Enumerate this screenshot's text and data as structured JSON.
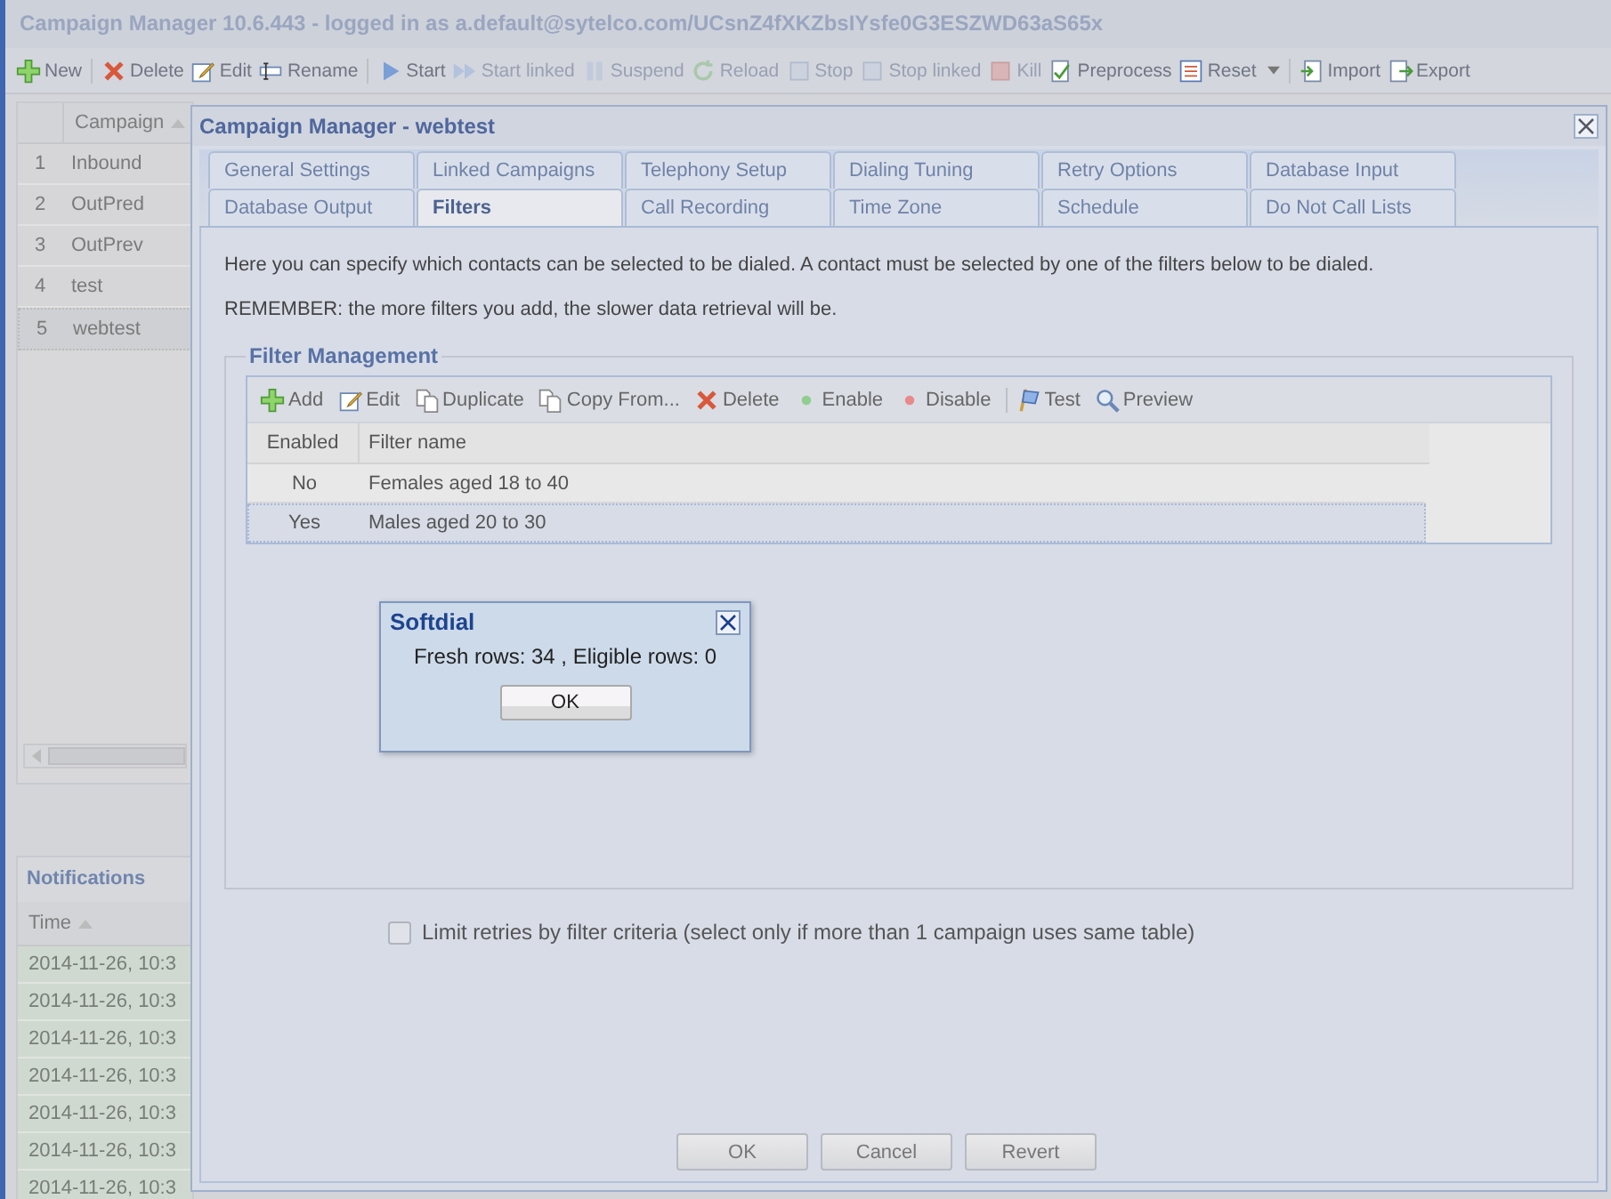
{
  "app": {
    "title": "Campaign Manager 10.6.443 - logged in as a.default@sytelco.com/UCsnZ4fXKZbsIYsfe0G3ESZWD63aS65x",
    "toolbar": [
      {
        "label": "New",
        "kind": "plus",
        "disabled": false,
        "caret": false,
        "sep_before": false
      },
      {
        "label": "Delete",
        "kind": "cross",
        "disabled": false,
        "caret": false,
        "sep_before": true
      },
      {
        "label": "Edit",
        "kind": "pencil",
        "disabled": false,
        "caret": false,
        "sep_before": false
      },
      {
        "label": "Rename",
        "kind": "rename",
        "disabled": false,
        "caret": false,
        "sep_before": false
      },
      {
        "label": "Start",
        "kind": "play",
        "disabled": false,
        "caret": false,
        "sep_before": true
      },
      {
        "label": "Start linked",
        "kind": "play2",
        "disabled": true,
        "caret": false,
        "sep_before": false
      },
      {
        "label": "Suspend",
        "kind": "pause",
        "disabled": true,
        "caret": false,
        "sep_before": false
      },
      {
        "label": "Reload",
        "kind": "reload",
        "disabled": true,
        "caret": false,
        "sep_before": false
      },
      {
        "label": "Stop",
        "kind": "stop",
        "disabled": true,
        "caret": false,
        "sep_before": false
      },
      {
        "label": "Stop linked",
        "kind": "stop",
        "disabled": true,
        "caret": false,
        "sep_before": false
      },
      {
        "label": "Kill",
        "kind": "kill",
        "disabled": true,
        "caret": false,
        "sep_before": false
      },
      {
        "label": "Preprocess",
        "kind": "check",
        "disabled": false,
        "caret": false,
        "sep_before": false
      },
      {
        "label": "Reset",
        "kind": "list",
        "disabled": false,
        "caret": true,
        "sep_before": false
      },
      {
        "label": "Import",
        "kind": "import",
        "disabled": false,
        "caret": false,
        "sep_before": true
      },
      {
        "label": "Export",
        "kind": "export",
        "disabled": false,
        "caret": false,
        "sep_before": false
      }
    ]
  },
  "campaign_grid": {
    "columns": [
      "Campaign"
    ],
    "rows": [
      {
        "number": "1",
        "name": "Inbound",
        "selected": false
      },
      {
        "number": "2",
        "name": "OutPred",
        "selected": false
      },
      {
        "number": "3",
        "name": "OutPrev",
        "selected": false
      },
      {
        "number": "4",
        "name": "test",
        "selected": false
      },
      {
        "number": "5",
        "name": "webtest",
        "selected": true
      }
    ]
  },
  "notifications": {
    "title": "Notifications",
    "columns": [
      "Time"
    ],
    "rows": [
      "2014-11-26, 10:3",
      "2014-11-26, 10:3",
      "2014-11-26, 10:3",
      "2014-11-26, 10:3",
      "2014-11-26, 10:3",
      "2014-11-26, 10:3",
      "2014-11-26, 10:3"
    ]
  },
  "dialog": {
    "title": "Campaign Manager - webtest",
    "tabs": [
      [
        {
          "label": "General Settings",
          "selected": false
        },
        {
          "label": "Linked Campaigns",
          "selected": false
        },
        {
          "label": "Telephony Setup",
          "selected": false
        },
        {
          "label": "Dialing Tuning",
          "selected": false
        },
        {
          "label": "Retry Options",
          "selected": false
        },
        {
          "label": "Database Input",
          "selected": false
        }
      ],
      [
        {
          "label": "Database Output",
          "selected": false
        },
        {
          "label": "Filters",
          "selected": true
        },
        {
          "label": "Call Recording",
          "selected": false
        },
        {
          "label": "Time Zone",
          "selected": false
        },
        {
          "label": "Schedule",
          "selected": false
        },
        {
          "label": "Do Not Call Lists",
          "selected": false
        }
      ]
    ],
    "intro": [
      "Here you can specify which contacts can be selected to be dialed. A contact must be selected by one of the filters below to be dialed.",
      "REMEMBER: the more filters you add, the slower data retrieval will be."
    ],
    "filter_management": {
      "title": "Filter Management",
      "toolbar": [
        {
          "label": "Add",
          "kind": "plus",
          "sep_before": false
        },
        {
          "label": "Edit",
          "kind": "pencil",
          "sep_before": false
        },
        {
          "label": "Duplicate",
          "kind": "pages",
          "sep_before": false
        },
        {
          "label": "Copy From...",
          "kind": "pages",
          "sep_before": false
        },
        {
          "label": "Delete",
          "kind": "cross",
          "sep_before": false
        },
        {
          "label": "Enable",
          "kind": "dot",
          "color": "#8fce8f",
          "sep_before": false
        },
        {
          "label": "Disable",
          "kind": "dot",
          "color": "#e88a8a",
          "sep_before": false
        },
        {
          "label": "Test",
          "kind": "flag",
          "sep_before": true
        },
        {
          "label": "Preview",
          "kind": "magnifier",
          "sep_before": false
        }
      ],
      "columns": [
        "Enabled",
        "Filter name"
      ],
      "rows": [
        {
          "enabled": "No",
          "name": "Females aged 18 to 40",
          "selected": false
        },
        {
          "enabled": "Yes",
          "name": "Males aged 20 to 30",
          "selected": true
        }
      ]
    },
    "limit_retries": {
      "label": "Limit retries by filter criteria (select only if more than 1 campaign uses same table)",
      "checked": false
    },
    "buttons": [
      "OK",
      "Cancel",
      "Revert"
    ]
  },
  "alert": {
    "title": "Softdial",
    "message": "Fresh rows: 34 , Eligible rows: 0",
    "button": "OK"
  }
}
